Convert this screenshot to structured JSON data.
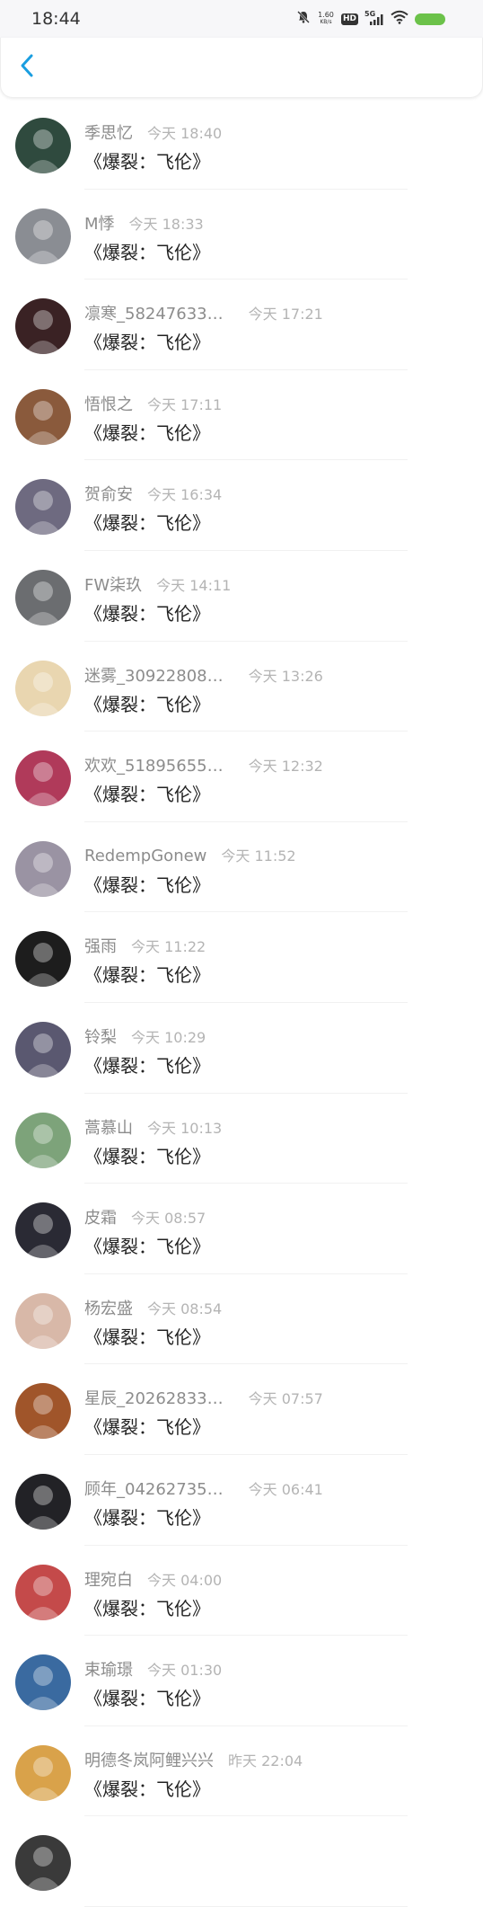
{
  "status_bar": {
    "time": "18:44",
    "net_speed_value": "1.60",
    "net_speed_unit": "KB/s",
    "hd_label": "HD",
    "network_label": "5G"
  },
  "header": {
    "back_icon": "chevron-left-icon",
    "accent_color": "#1a9ee0"
  },
  "rows": [
    {
      "name": "季思忆",
      "time": "今天 18:40",
      "message": "《爆裂：飞伦》",
      "avatar_color": "#2f4a3e"
    },
    {
      "name": "M悸",
      "time": "今天 18:33",
      "message": "《爆裂：飞伦》",
      "avatar_color": "#8a8d93"
    },
    {
      "name": "凛寒_58247633…",
      "time": "今天 17:21",
      "message": "《爆裂：飞伦》",
      "avatar_color": "#3a2224"
    },
    {
      "name": "悟恨之",
      "time": "今天 17:11",
      "message": "《爆裂：飞伦》",
      "avatar_color": "#8a5a3c"
    },
    {
      "name": "贺俞安",
      "time": "今天 16:34",
      "message": "《爆裂：飞伦》",
      "avatar_color": "#6e6a80"
    },
    {
      "name": "FW柒玖",
      "time": "今天 14:11",
      "message": "《爆裂：飞伦》",
      "avatar_color": "#6b6d70"
    },
    {
      "name": "迷雾_30922808…",
      "time": "今天 13:26",
      "message": "《爆裂：飞伦》",
      "avatar_color": "#e9d6b0"
    },
    {
      "name": "欢欢_51895655…",
      "time": "今天 12:32",
      "message": "《爆裂：飞伦》",
      "avatar_color": "#b03a5a"
    },
    {
      "name": "RedempGonew",
      "time": "今天 11:52",
      "message": "《爆裂：飞伦》",
      "avatar_color": "#9a93a3"
    },
    {
      "name": "强雨",
      "time": "今天 11:22",
      "message": "《爆裂：飞伦》",
      "avatar_color": "#1d1d1d"
    },
    {
      "name": "铃梨",
      "time": "今天 10:29",
      "message": "《爆裂：飞伦》",
      "avatar_color": "#5a5870"
    },
    {
      "name": "蒿慕山",
      "time": "今天 10:13",
      "message": "《爆裂：飞伦》",
      "avatar_color": "#7da37a"
    },
    {
      "name": "皮霜",
      "time": "今天 08:57",
      "message": "《爆裂：飞伦》",
      "avatar_color": "#2a2a34"
    },
    {
      "name": "杨宏盛",
      "time": "今天 08:54",
      "message": "《爆裂：飞伦》",
      "avatar_color": "#d8b8a8"
    },
    {
      "name": "星辰_20262833…",
      "time": "今天 07:57",
      "message": "《爆裂：飞伦》",
      "avatar_color": "#a0552a"
    },
    {
      "name": "顾年_04262735…",
      "time": "今天 06:41",
      "message": "《爆裂：飞伦》",
      "avatar_color": "#222226"
    },
    {
      "name": "理宛白",
      "time": "今天 04:00",
      "message": "《爆裂：飞伦》",
      "avatar_color": "#c44a4a"
    },
    {
      "name": "束瑜璟",
      "time": "今天 01:30",
      "message": "《爆裂：飞伦》",
      "avatar_color": "#3a6aa0"
    },
    {
      "name": "明德冬岚阿鲤兴兴",
      "time": "昨天 22:04",
      "message": "《爆裂：飞伦》",
      "avatar_color": "#d9a24a"
    },
    {
      "name": "",
      "time": "",
      "message": "",
      "avatar_color": "#3a3a3a"
    }
  ]
}
